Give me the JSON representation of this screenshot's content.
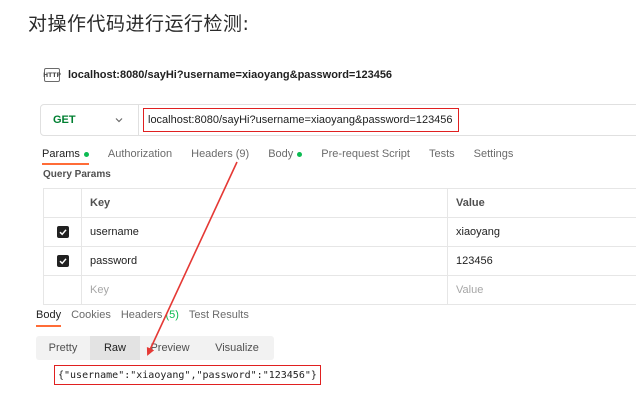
{
  "heading": "对操作代码进行运行检测:",
  "request": {
    "icon_text": "HTTP",
    "title": "localhost:8080/sayHi?username=xiaoyang&password=123456",
    "method": "GET",
    "url": "localhost:8080/sayHi?username=xiaoyang&password=123456"
  },
  "request_tabs": [
    {
      "label": "Params",
      "dot": true
    },
    {
      "label": "Authorization"
    },
    {
      "label": "Headers",
      "count": "(9)"
    },
    {
      "label": "Body",
      "dot": true
    },
    {
      "label": "Pre-request Script"
    },
    {
      "label": "Tests"
    },
    {
      "label": "Settings"
    }
  ],
  "query_params": {
    "title": "Query Params",
    "header": {
      "key": "Key",
      "value": "Value"
    },
    "rows": [
      {
        "key": "username",
        "value": "xiaoyang",
        "checked": true
      },
      {
        "key": "password",
        "value": "123456",
        "checked": true
      }
    ],
    "placeholder": {
      "key": "Key",
      "value": "Value"
    }
  },
  "response_tabs": [
    {
      "label": "Body"
    },
    {
      "label": "Cookies"
    },
    {
      "label": "Headers",
      "count": "(5)"
    },
    {
      "label": "Test Results"
    }
  ],
  "format_buttons": [
    "Pretty",
    "Raw",
    "Preview",
    "Visualize"
  ],
  "selected_format": "Raw",
  "response_body": "{\"username\":\"xiaoyang\",\"password\":\"123456\"}",
  "colors": {
    "accent": "#ff6c37",
    "highlight_box": "#e02020",
    "method_get": "#007f31",
    "dot": "#0cbb52"
  }
}
